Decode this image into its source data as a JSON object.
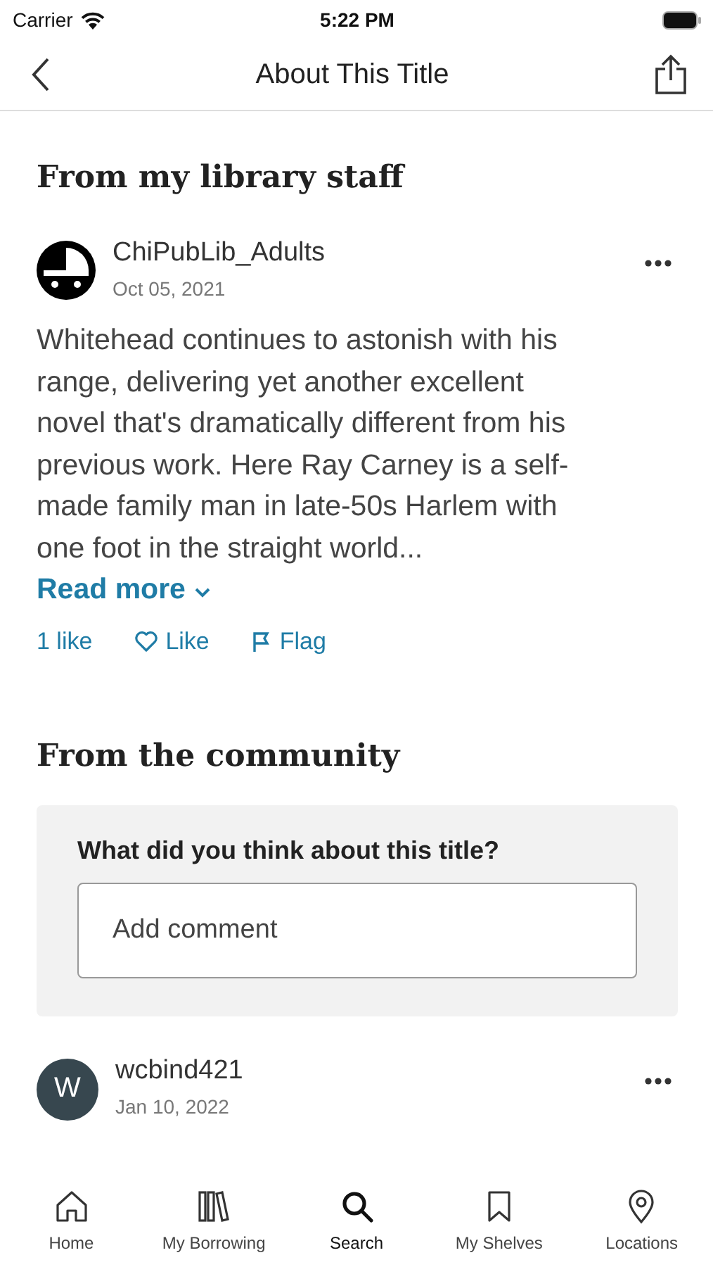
{
  "status_bar": {
    "carrier": "Carrier",
    "time": "5:22 PM"
  },
  "header": {
    "title": "About This Title"
  },
  "staff_section": {
    "heading": "From my library staff",
    "review": {
      "avatar": {
        "kind": "logo"
      },
      "author": "ChiPubLib_Adults",
      "date": "Oct 05, 2021",
      "text": "Whitehead continues to astonish with his range, delivering yet another excellent novel that's dramatically different from his previous work. Here Ray Carney is a self-made family man in late-50s Harlem with one foot in the straight world...",
      "read_more": "Read more",
      "like_count": "1 like",
      "like_label": "Like",
      "liked": false,
      "flag_label": "Flag"
    }
  },
  "community_section": {
    "heading": "From the community",
    "prompt": "What did you think about this title?",
    "comment_placeholder": "Add comment",
    "comments": [
      {
        "avatar": {
          "kind": "initial",
          "letter": "W"
        },
        "author": "wcbind421",
        "date": "Jan 10, 2022"
      }
    ]
  },
  "tab_bar": [
    {
      "label": "Home",
      "selected": false
    },
    {
      "label": "My Borrowing",
      "selected": false
    },
    {
      "label": "Search",
      "selected": true
    },
    {
      "label": "My Shelves",
      "selected": false
    },
    {
      "label": "Locations",
      "selected": false
    }
  ]
}
